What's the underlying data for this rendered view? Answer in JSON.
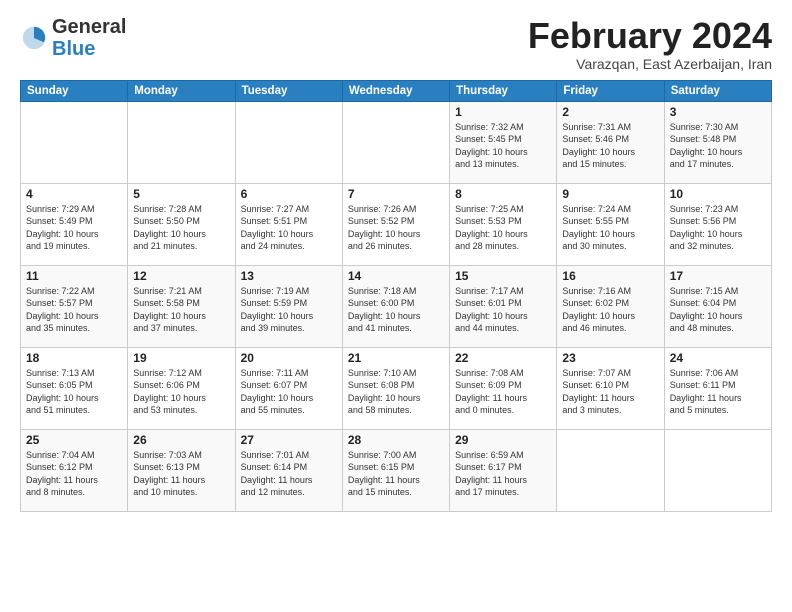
{
  "logo": {
    "general": "General",
    "blue": "Blue"
  },
  "header": {
    "title": "February 2024",
    "subtitle": "Varazqan, East Azerbaijan, Iran"
  },
  "weekdays": [
    "Sunday",
    "Monday",
    "Tuesday",
    "Wednesday",
    "Thursday",
    "Friday",
    "Saturday"
  ],
  "weeks": [
    [
      {
        "day": "",
        "info": ""
      },
      {
        "day": "",
        "info": ""
      },
      {
        "day": "",
        "info": ""
      },
      {
        "day": "",
        "info": ""
      },
      {
        "day": "1",
        "info": "Sunrise: 7:32 AM\nSunset: 5:45 PM\nDaylight: 10 hours\nand 13 minutes."
      },
      {
        "day": "2",
        "info": "Sunrise: 7:31 AM\nSunset: 5:46 PM\nDaylight: 10 hours\nand 15 minutes."
      },
      {
        "day": "3",
        "info": "Sunrise: 7:30 AM\nSunset: 5:48 PM\nDaylight: 10 hours\nand 17 minutes."
      }
    ],
    [
      {
        "day": "4",
        "info": "Sunrise: 7:29 AM\nSunset: 5:49 PM\nDaylight: 10 hours\nand 19 minutes."
      },
      {
        "day": "5",
        "info": "Sunrise: 7:28 AM\nSunset: 5:50 PM\nDaylight: 10 hours\nand 21 minutes."
      },
      {
        "day": "6",
        "info": "Sunrise: 7:27 AM\nSunset: 5:51 PM\nDaylight: 10 hours\nand 24 minutes."
      },
      {
        "day": "7",
        "info": "Sunrise: 7:26 AM\nSunset: 5:52 PM\nDaylight: 10 hours\nand 26 minutes."
      },
      {
        "day": "8",
        "info": "Sunrise: 7:25 AM\nSunset: 5:53 PM\nDaylight: 10 hours\nand 28 minutes."
      },
      {
        "day": "9",
        "info": "Sunrise: 7:24 AM\nSunset: 5:55 PM\nDaylight: 10 hours\nand 30 minutes."
      },
      {
        "day": "10",
        "info": "Sunrise: 7:23 AM\nSunset: 5:56 PM\nDaylight: 10 hours\nand 32 minutes."
      }
    ],
    [
      {
        "day": "11",
        "info": "Sunrise: 7:22 AM\nSunset: 5:57 PM\nDaylight: 10 hours\nand 35 minutes."
      },
      {
        "day": "12",
        "info": "Sunrise: 7:21 AM\nSunset: 5:58 PM\nDaylight: 10 hours\nand 37 minutes."
      },
      {
        "day": "13",
        "info": "Sunrise: 7:19 AM\nSunset: 5:59 PM\nDaylight: 10 hours\nand 39 minutes."
      },
      {
        "day": "14",
        "info": "Sunrise: 7:18 AM\nSunset: 6:00 PM\nDaylight: 10 hours\nand 41 minutes."
      },
      {
        "day": "15",
        "info": "Sunrise: 7:17 AM\nSunset: 6:01 PM\nDaylight: 10 hours\nand 44 minutes."
      },
      {
        "day": "16",
        "info": "Sunrise: 7:16 AM\nSunset: 6:02 PM\nDaylight: 10 hours\nand 46 minutes."
      },
      {
        "day": "17",
        "info": "Sunrise: 7:15 AM\nSunset: 6:04 PM\nDaylight: 10 hours\nand 48 minutes."
      }
    ],
    [
      {
        "day": "18",
        "info": "Sunrise: 7:13 AM\nSunset: 6:05 PM\nDaylight: 10 hours\nand 51 minutes."
      },
      {
        "day": "19",
        "info": "Sunrise: 7:12 AM\nSunset: 6:06 PM\nDaylight: 10 hours\nand 53 minutes."
      },
      {
        "day": "20",
        "info": "Sunrise: 7:11 AM\nSunset: 6:07 PM\nDaylight: 10 hours\nand 55 minutes."
      },
      {
        "day": "21",
        "info": "Sunrise: 7:10 AM\nSunset: 6:08 PM\nDaylight: 10 hours\nand 58 minutes."
      },
      {
        "day": "22",
        "info": "Sunrise: 7:08 AM\nSunset: 6:09 PM\nDaylight: 11 hours\nand 0 minutes."
      },
      {
        "day": "23",
        "info": "Sunrise: 7:07 AM\nSunset: 6:10 PM\nDaylight: 11 hours\nand 3 minutes."
      },
      {
        "day": "24",
        "info": "Sunrise: 7:06 AM\nSunset: 6:11 PM\nDaylight: 11 hours\nand 5 minutes."
      }
    ],
    [
      {
        "day": "25",
        "info": "Sunrise: 7:04 AM\nSunset: 6:12 PM\nDaylight: 11 hours\nand 8 minutes."
      },
      {
        "day": "26",
        "info": "Sunrise: 7:03 AM\nSunset: 6:13 PM\nDaylight: 11 hours\nand 10 minutes."
      },
      {
        "day": "27",
        "info": "Sunrise: 7:01 AM\nSunset: 6:14 PM\nDaylight: 11 hours\nand 12 minutes."
      },
      {
        "day": "28",
        "info": "Sunrise: 7:00 AM\nSunset: 6:15 PM\nDaylight: 11 hours\nand 15 minutes."
      },
      {
        "day": "29",
        "info": "Sunrise: 6:59 AM\nSunset: 6:17 PM\nDaylight: 11 hours\nand 17 minutes."
      },
      {
        "day": "",
        "info": ""
      },
      {
        "day": "",
        "info": ""
      }
    ]
  ]
}
